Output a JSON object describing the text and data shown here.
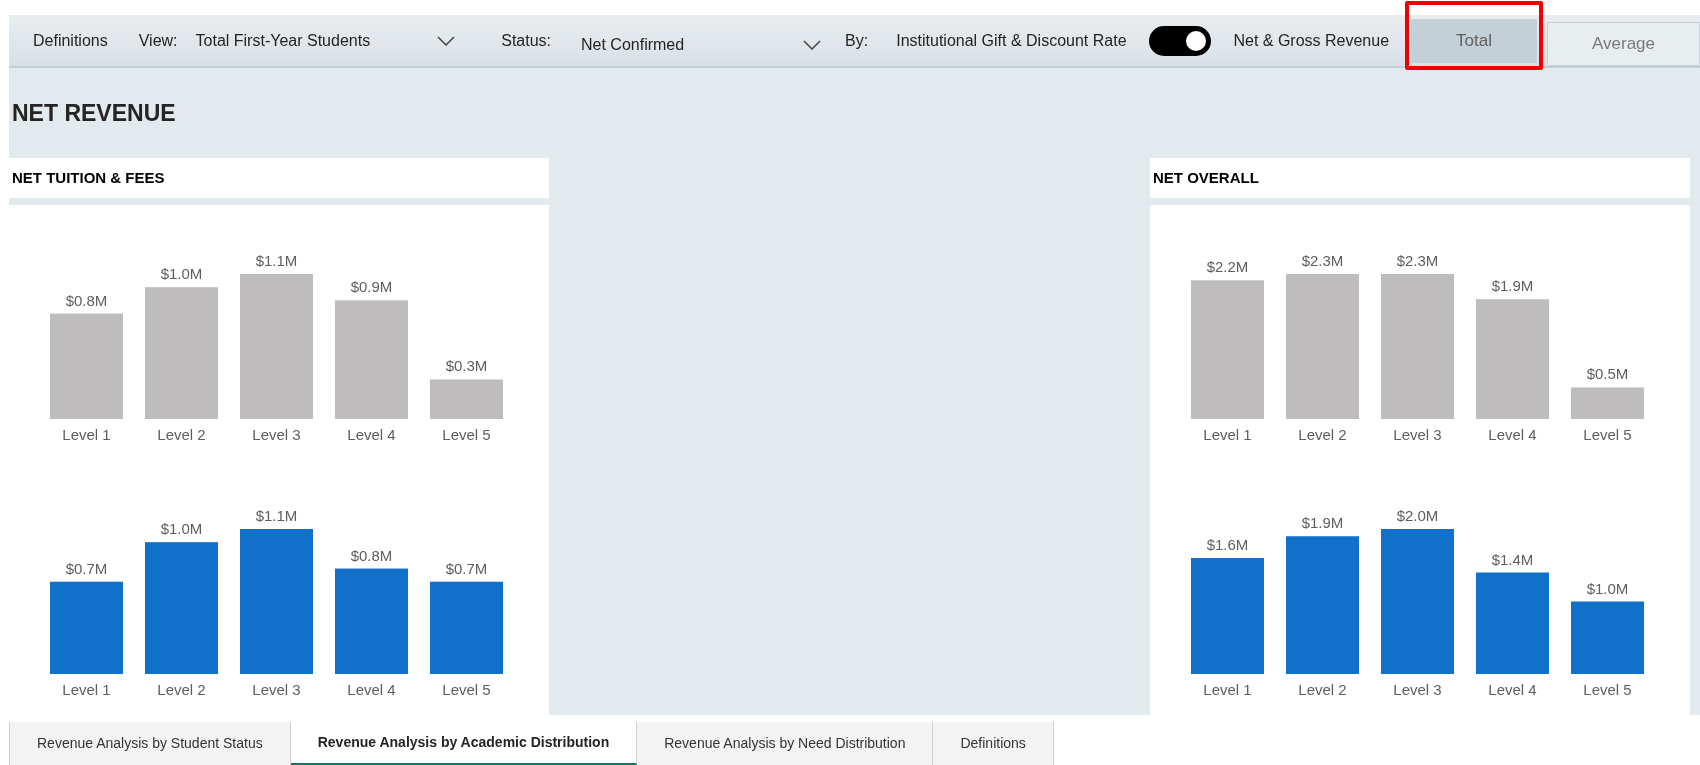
{
  "toolbar": {
    "definitions_link": "Definitions",
    "view": {
      "label": "View:",
      "value": "Total First-Year Students"
    },
    "status": {
      "label": "Status:",
      "value": "Net Confirmed"
    },
    "by": {
      "label": "By:",
      "left_option": "Institutional Gift & Discount Rate",
      "toggle_on": true,
      "right_option": "Net & Gross Revenue"
    },
    "buttons": [
      {
        "label": "Total",
        "selected": true,
        "highlighted": true
      },
      {
        "label": "Average",
        "selected": false,
        "highlighted": false
      }
    ]
  },
  "page_title": "NET REVENUE",
  "cards": [
    {
      "title": "NET TUITION & FEES",
      "charts": [
        {
          "chart_data": {
            "type": "bar",
            "categories": [
              "Level 1",
              "Level 2",
              "Level 3",
              "Level 4",
              "Level 5"
            ],
            "series": [
              {
                "color": "#bebcbd",
                "values": [
                  800000,
                  1000000,
                  1100000,
                  900000,
                  300000
                ],
                "value_labels": [
                  "$0.8M",
                  "$1.0M",
                  "$1.1M",
                  "$0.9M",
                  "$0.3M"
                ]
              }
            ]
          }
        },
        {
          "chart_data": {
            "type": "bar",
            "categories": [
              "Level 1",
              "Level 2",
              "Level 3",
              "Level 4",
              "Level 5"
            ],
            "series": [
              {
                "color": "#1170c9",
                "values": [
                  700000,
                  1000000,
                  1100000,
                  800000,
                  700000
                ],
                "value_labels": [
                  "$0.7M",
                  "$1.0M",
                  "$1.1M",
                  "$0.8M",
                  "$0.7M"
                ]
              }
            ]
          }
        }
      ]
    },
    {
      "title": "NET OVERALL",
      "charts": [
        {
          "chart_data": {
            "type": "bar",
            "categories": [
              "Level 1",
              "Level 2",
              "Level 3",
              "Level 4",
              "Level 5"
            ],
            "series": [
              {
                "color": "#bebcbd",
                "values": [
                  2200000,
                  2300000,
                  2300000,
                  1900000,
                  500000
                ],
                "value_labels": [
                  "$2.2M",
                  "$2.3M",
                  "$2.3M",
                  "$1.9M",
                  "$0.5M"
                ]
              }
            ]
          }
        },
        {
          "chart_data": {
            "type": "bar",
            "categories": [
              "Level 1",
              "Level 2",
              "Level 3",
              "Level 4",
              "Level 5"
            ],
            "series": [
              {
                "color": "#1170c9",
                "values": [
                  1600000,
                  1900000,
                  2000000,
                  1400000,
                  1000000
                ],
                "value_labels": [
                  "$1.6M",
                  "$1.9M",
                  "$2.0M",
                  "$1.4M",
                  "$1.0M"
                ]
              }
            ]
          }
        }
      ]
    }
  ],
  "page_tabs": [
    {
      "label": "Revenue Analysis by Student Status",
      "selected": false
    },
    {
      "label": "Revenue Analysis by Academic Distribution",
      "selected": true
    },
    {
      "label": "Revenue Analysis by Need Distribution",
      "selected": false
    },
    {
      "label": "Definitions",
      "selected": false
    }
  ]
}
